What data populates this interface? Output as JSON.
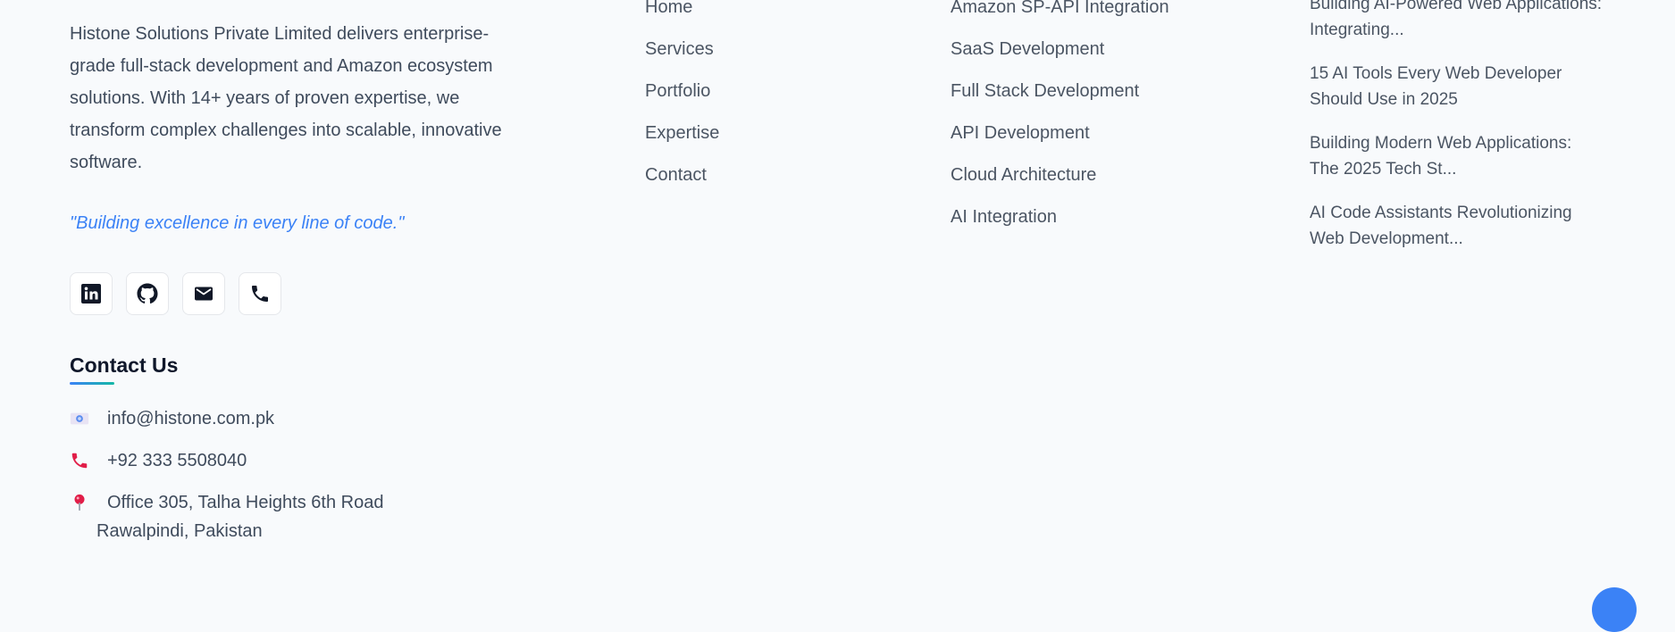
{
  "about": {
    "text": "Histone Solutions Private Limited delivers enterprise-grade full-stack development and Amazon ecosystem solutions. With 14+ years of proven expertise, we transform complex challenges into scalable, innovative software.",
    "quote": "\"Building excellence in every line of code.\""
  },
  "social": [
    {
      "icon": "linkedin-icon"
    },
    {
      "icon": "github-icon"
    },
    {
      "icon": "mail-icon"
    },
    {
      "icon": "phone-icon"
    }
  ],
  "contact": {
    "title": "Contact Us",
    "email": "info@histone.com.pk",
    "phone": "+92 333 5508040",
    "address_line1": "Office 305, Talha Heights 6th Road",
    "address_line2": "Rawalpindi, Pakistan"
  },
  "quick_links": [
    "Home",
    "Services",
    "Portfolio",
    "Expertise",
    "Contact"
  ],
  "services": [
    "Amazon SP-API Integration",
    "SaaS Development",
    "Full Stack Development",
    "API Development",
    "Cloud Architecture",
    "AI Integration"
  ],
  "blog_posts": [
    "Building AI-Powered Web Applications: Integrating...",
    "15 AI Tools Every Web Developer Should Use in 2025",
    "Building Modern Web Applications: The 2025 Tech St...",
    "AI Code Assistants Revolutionizing Web Development..."
  ],
  "colors": {
    "accent": "#3b82f6",
    "teal": "#14b8a6",
    "pink": "#e11d48",
    "heading": "#0f172a",
    "background": "#f8fafc"
  }
}
